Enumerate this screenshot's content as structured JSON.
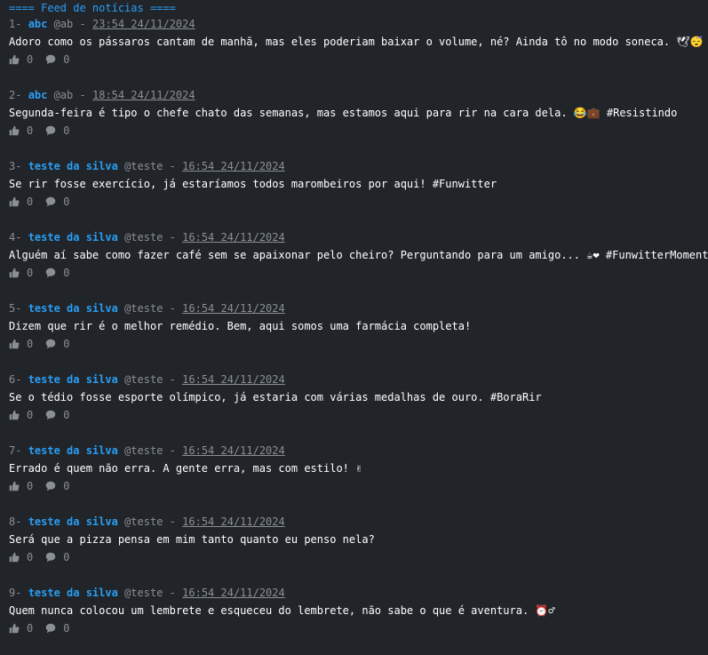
{
  "feed": {
    "header": "==== Feed de notícias ====",
    "like_icon": "thumbs-up-icon",
    "comment_icon": "comment-icon",
    "accent_color": "#2a9df4",
    "muted_color": "#8a8f95",
    "background_color": "#212529"
  },
  "posts": [
    {
      "num": "1-",
      "name": "abc",
      "handle": "@ab",
      "sep": "-",
      "time": "23:54 24/11/2024",
      "text": "Adoro como os pássaros cantam de manhã, mas eles poderiam baixar o volume, né? Ainda tô no modo soneca. 🕊😴",
      "likes": "0",
      "comments": "0"
    },
    {
      "num": "2-",
      "name": "abc",
      "handle": "@ab",
      "sep": "-",
      "time": "18:54 24/11/2024",
      "text": "Segunda-feira é tipo o chefe chato das semanas, mas estamos aqui para rir na cara dela. 😂💼 #Resistindo",
      "likes": "0",
      "comments": "0"
    },
    {
      "num": "3-",
      "name": "teste da silva",
      "handle": "@teste",
      "sep": "-",
      "time": "16:54 24/11/2024",
      "text": "Se rir fosse exercício, já estaríamos todos marombeiros por aqui! #Funwitter",
      "likes": "0",
      "comments": "0"
    },
    {
      "num": "4-",
      "name": "teste da silva",
      "handle": "@teste",
      "sep": "-",
      "time": "16:54 24/11/2024",
      "text": "Alguém aí sabe como fazer café sem se apaixonar pelo cheiro? Perguntando para um amigo... ☕❤ #FunwitterMoment",
      "likes": "0",
      "comments": "0"
    },
    {
      "num": "5-",
      "name": "teste da silva",
      "handle": "@teste",
      "sep": "-",
      "time": "16:54 24/11/2024",
      "text": "Dizem que rir é o melhor remédio. Bem, aqui somos uma farmácia completa!",
      "likes": "0",
      "comments": "0"
    },
    {
      "num": "6-",
      "name": "teste da silva",
      "handle": "@teste",
      "sep": "-",
      "time": "16:54 24/11/2024",
      "text": "Se o tédio fosse esporte olímpico, já estaria com várias medalhas de ouro. #BoraRir",
      "likes": "0",
      "comments": "0"
    },
    {
      "num": "7-",
      "name": "teste da silva",
      "handle": "@teste",
      "sep": "-",
      "time": "16:54 24/11/2024",
      "text": "Errado é quem não erra. A gente erra, mas com estilo! ✌",
      "likes": "0",
      "comments": "0"
    },
    {
      "num": "8-",
      "name": "teste da silva",
      "handle": "@teste",
      "sep": "-",
      "time": "16:54 24/11/2024",
      "text": "Será que a pizza pensa em mim tanto quanto eu penso nela?",
      "likes": "0",
      "comments": "0"
    },
    {
      "num": "9-",
      "name": "teste da silva",
      "handle": "@teste",
      "sep": "-",
      "time": "16:54 24/11/2024",
      "text": "Quem nunca colocou um lembrete e esqueceu do lembrete, não sabe o que é aventura. ⏰♂",
      "likes": "0",
      "comments": "0"
    }
  ]
}
